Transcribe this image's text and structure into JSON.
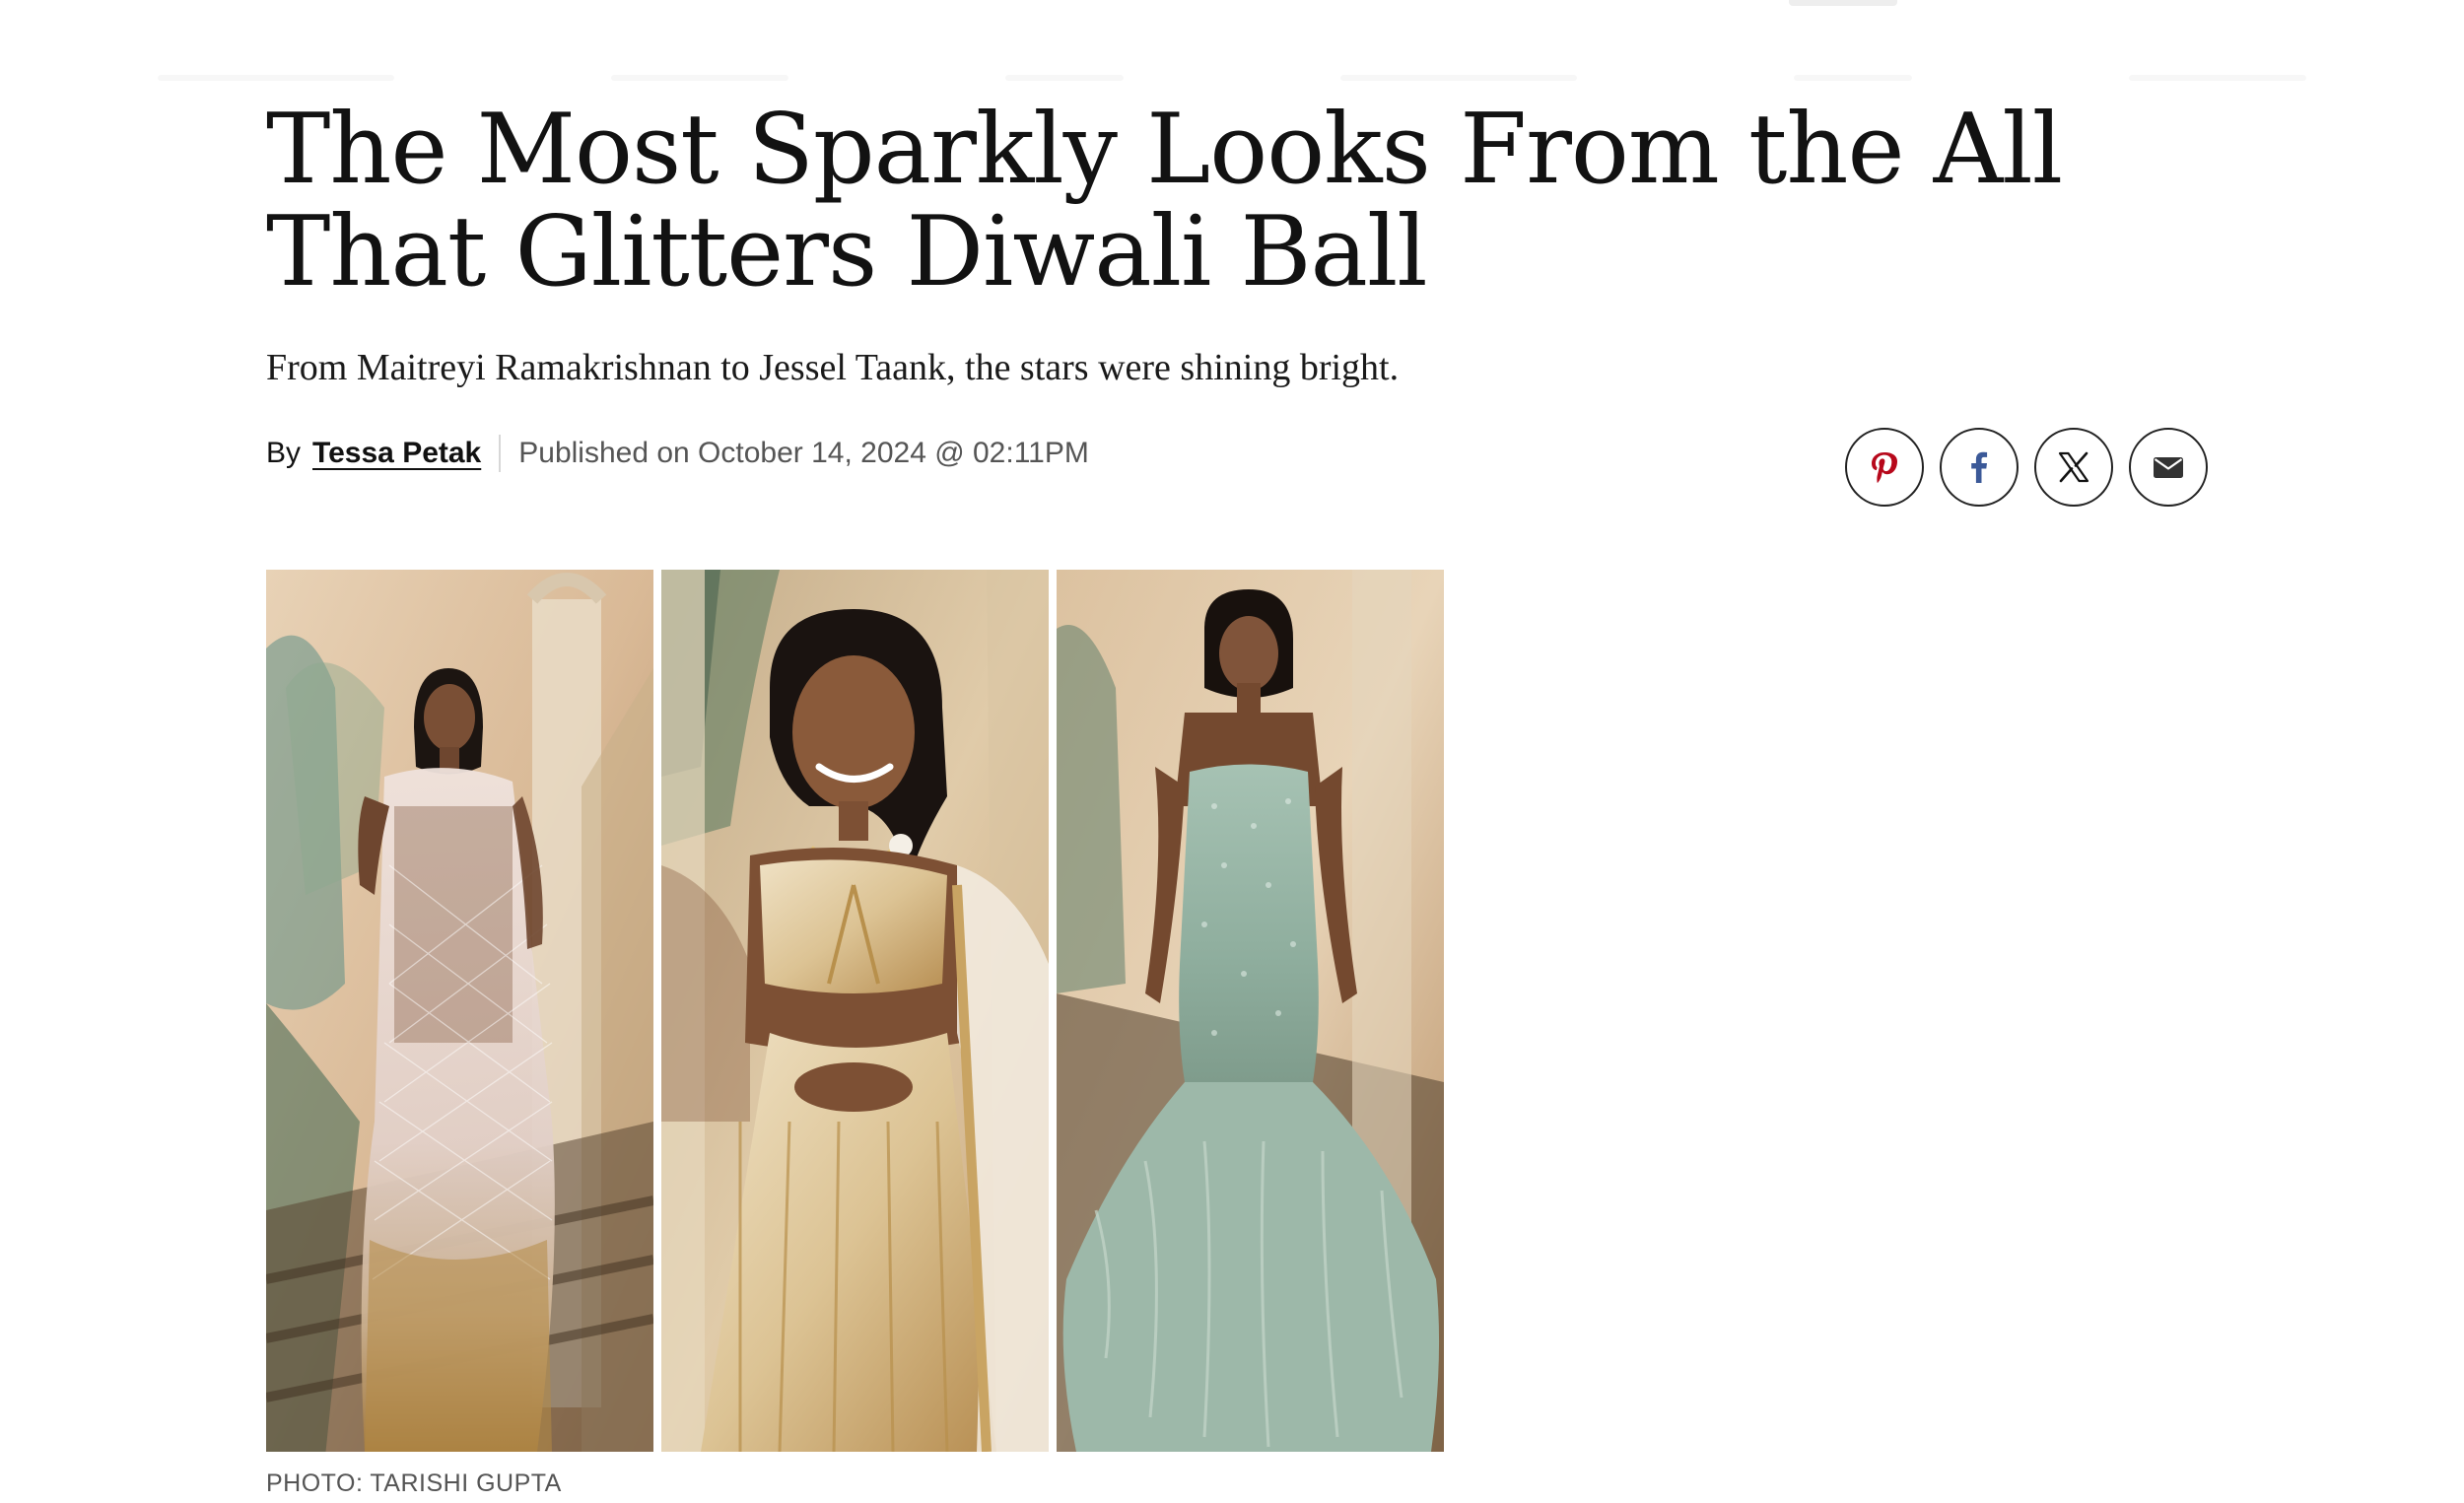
{
  "article": {
    "headline": "The Most Sparkly Looks From the All That Glitters Diwali Ball",
    "dek": "From Maitreyi Ramakrishnan to Jessel Taank, the stars were shining bright.",
    "byline": {
      "by": "By",
      "author": "Tessa Petak",
      "published": "Published on October 14, 2024 @ 02:11PM"
    },
    "share": [
      {
        "icon": "pinterest-icon",
        "color": "#b7081b"
      },
      {
        "icon": "facebook-icon",
        "color": "#3b5998"
      },
      {
        "icon": "x-icon",
        "color": "#111111"
      },
      {
        "icon": "email-icon",
        "color": "#333333"
      }
    ],
    "photo": {
      "panels": [
        {
          "subject": "woman in sheer sequined silver and gold saree on staircase"
        },
        {
          "subject": "woman in gold embellished lehenga with flowers in braided hair"
        },
        {
          "subject": "woman in strapless mint feathered mermaid gown"
        }
      ],
      "credit": "PHOTO: TARISHI GUPTA"
    }
  },
  "colors": {
    "text": "#121212",
    "meta_gray": "#555555",
    "pinterest": "#b7081b",
    "facebook": "#3b5998"
  }
}
